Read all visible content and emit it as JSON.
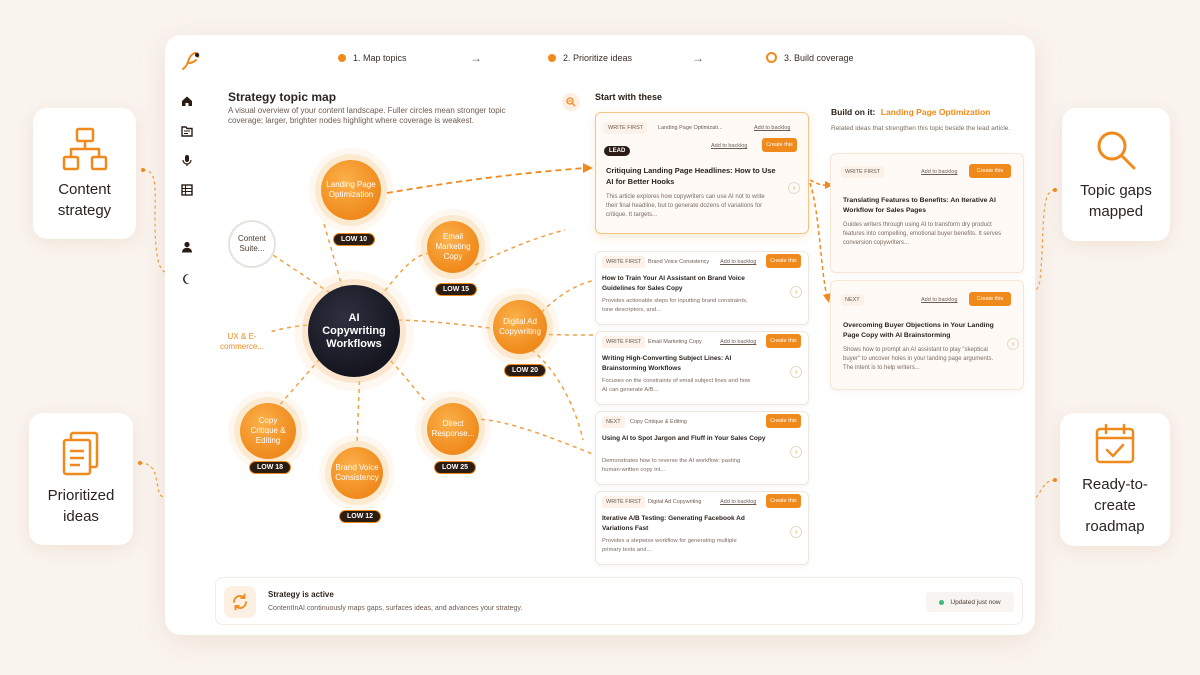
{
  "features": {
    "left_top": "Content strategy",
    "left_bottom": "Prioritized ideas",
    "right_top": "Topic gaps mapped",
    "right_bottom": "Ready-to-create roadmap"
  },
  "steps": [
    {
      "label": "1. Map topics"
    },
    {
      "label": "2. Prioritize ideas"
    },
    {
      "label": "3. Build coverage"
    }
  ],
  "map": {
    "title": "Strategy topic map",
    "description": "A visual overview of your content landscape. Fuller circles mean stronger topic coverage; larger, brighter nodes highlight where coverage is weakest.",
    "center": "AI Copywriting Workflows",
    "nodes": [
      {
        "label": "Landing Page Optimization",
        "badge": "LOW 10"
      },
      {
        "label": "Email Marketing Copy",
        "badge": "LOW 15"
      },
      {
        "label": "Digital Ad Copywriting",
        "badge": "LOW 20"
      },
      {
        "label": "Direct Response...",
        "badge": "LOW 25"
      },
      {
        "label": "Brand Voice Consistency",
        "badge": "LOW 12"
      },
      {
        "label": "Copy Critique & Editing",
        "badge": "LOW 18"
      }
    ],
    "ghost_nodes": [
      {
        "label": "Content Suite..."
      },
      {
        "label": "UX & E-commerce..."
      }
    ]
  },
  "start": {
    "heading": "Start with these",
    "cards": [
      {
        "tag": "WRITE FIRST",
        "source": "Landing Page Optimizati...",
        "backlog": "Add to backlog",
        "lead": "LEAD",
        "create": "Create this",
        "title": "Critiquing Landing Page Headlines: How to Use AI for Better Hooks",
        "desc": "This article explores how copywriters can use AI not to write their final headline, but to generate dozens of variations for critique. It targets..."
      },
      {
        "tag": "WRITE FIRST",
        "source": "Brand Voice Consistency",
        "backlog": "Add to backlog",
        "create": "Create this",
        "title": "How to Train Your AI Assistant on Brand Voice Guidelines for Sales Copy",
        "desc": "Provides actionable steps for inputting brand constraints, tone descriptors, and..."
      },
      {
        "tag": "WRITE FIRST",
        "source": "Email Marketing Copy",
        "backlog": "Add to backlog",
        "create": "Create this",
        "title": "Writing High-Converting Subject Lines: AI Brainstorming Workflows",
        "desc": "Focuses on the constraints of email subject lines and how AI can generate A/B..."
      },
      {
        "tag": "NEXT",
        "source": "Copy Critique & Editing",
        "backlog": "",
        "create": "Create this",
        "title": "Using AI to Spot Jargon and Fluff in Your Sales Copy",
        "desc": "Demonstrates how to reverse the AI workflow: pasting human-written copy int..."
      },
      {
        "tag": "WRITE FIRST",
        "source": "Digital Ad Copywriting",
        "backlog": "Add to backlog",
        "create": "Create this",
        "title": "Iterative A/B Testing: Generating Facebook Ad Variations Fast",
        "desc": "Provides a stepwise workflow for generating multiple primary texts and..."
      }
    ]
  },
  "build": {
    "heading": "Build on it:",
    "topic": "Landing Page Optimization",
    "desc": "Related ideas that strengthen this topic beside the lead article.",
    "cards": [
      {
        "tag": "WRITE FIRST",
        "backlog": "Add to backlog",
        "create": "Create this",
        "title": "Translating Features to Benefits: An Iterative AI Workflow for Sales Pages",
        "desc": "Guides writers through using AI to transform dry product features into compelling, emotional buyer benefits. It serves conversion copywriters..."
      },
      {
        "tag": "NEXT",
        "backlog": "Add to backlog",
        "create": "Create this",
        "title": "Overcoming Buyer Objections in Your Landing Page Copy with AI Brainstorming",
        "desc": "Shows how to prompt an AI assistant to play \"skeptical buyer\" to uncover holes in your landing page arguments. The intent is to help writers..."
      }
    ]
  },
  "status": {
    "title": "Strategy is active",
    "desc": "ContentInAI continuously maps gaps, surfaces ideas, and advances your strategy.",
    "updated": "Updated just now"
  },
  "colors": {
    "accent": "#f08a1c",
    "dark": "#1c1e2a",
    "background": "#faf4ef"
  }
}
